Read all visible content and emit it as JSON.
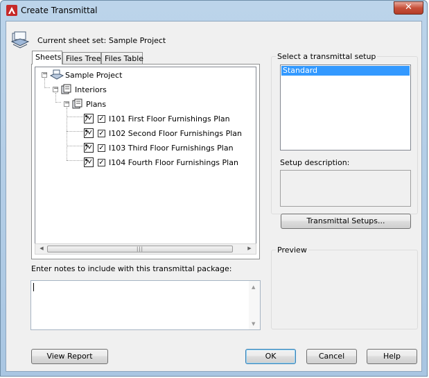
{
  "window": {
    "title": "Create Transmittal"
  },
  "sheet_set": {
    "label": "Current sheet set: Sample Project"
  },
  "tabs": [
    {
      "label": "Sheets",
      "active": true
    },
    {
      "label": "Files Tree",
      "active": false
    },
    {
      "label": "Files Table",
      "active": false
    }
  ],
  "tree": {
    "root": "Sample Project",
    "subset": "Interiors",
    "subsubset": "Plans",
    "sheets": [
      {
        "label": "I101 First Floor Furnishings Plan",
        "checked": true
      },
      {
        "label": "I102 Second Floor Furnishings Plan",
        "checked": true
      },
      {
        "label": "I103 Third Floor Furnishings Plan",
        "checked": true
      },
      {
        "label": "I104 Fourth Floor Furnishings Plan",
        "checked": true
      }
    ]
  },
  "notes": {
    "label": "Enter notes to include with this transmittal package:",
    "value": ""
  },
  "setup": {
    "label": "Select a transmittal setup",
    "options": [
      "Standard"
    ],
    "selected": "Standard",
    "description_label": "Setup description:",
    "description": "",
    "setups_button": "Transmittal Setups..."
  },
  "preview": {
    "label": "Preview"
  },
  "buttons": {
    "view_report": "View Report",
    "ok": "OK",
    "cancel": "Cancel",
    "help": "Help"
  },
  "icons": {
    "close": "close-icon",
    "app": "autocad-logo-icon"
  },
  "colors": {
    "selection": "#3399ff",
    "close_button": "#c7503a",
    "title_bar": "#bcd4ea"
  }
}
